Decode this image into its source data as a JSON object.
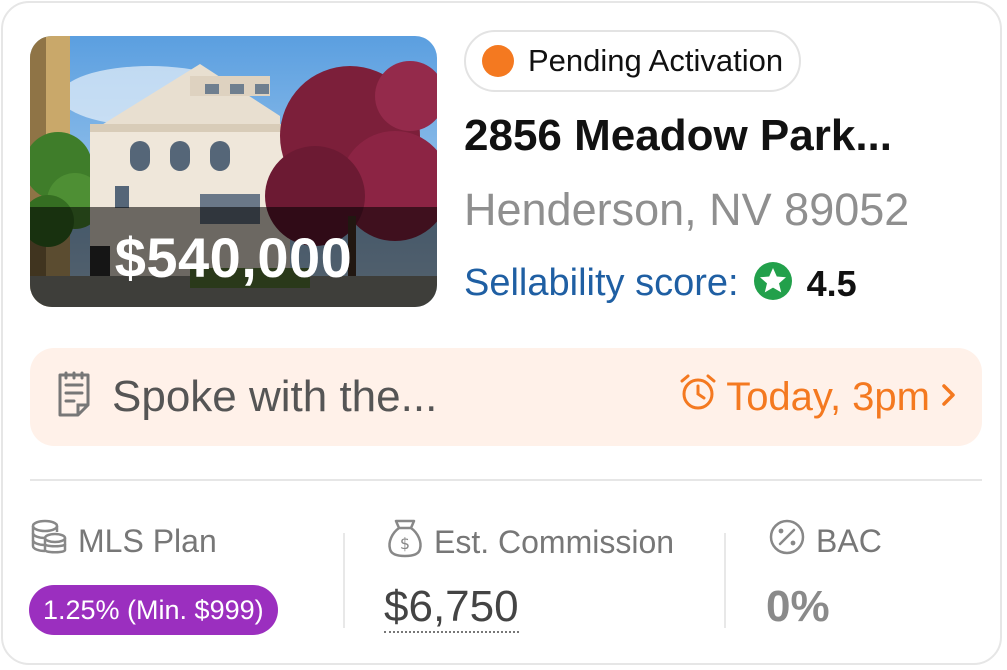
{
  "listing": {
    "price": "$540,000",
    "status": "Pending Activation",
    "address": "2856 Meadow Park...",
    "city": "Henderson, NV 89052",
    "sellability_label": "Sellability score:",
    "sellability_value": "4.5"
  },
  "note": {
    "text": "Spoke with the...",
    "when": "Today, 3pm"
  },
  "stats": {
    "mls_label": "MLS Plan",
    "mls_value": "1.25% (Min. $999)",
    "commission_label": "Est. Commission",
    "commission_value": "$6,750",
    "bac_label": "BAC",
    "bac_value": "0%"
  },
  "colors": {
    "status_dot": "#f47920",
    "accent_orange": "#f47920",
    "score_blue": "#1f5fa3",
    "score_green": "#22a04b",
    "note_bg": "#fff1e9",
    "badge_purple": "#9b2fbf"
  },
  "icons": {
    "status": "status-dot",
    "score": "star-badge-icon",
    "note": "note-icon",
    "time": "alarm-clock-icon",
    "chevron": "chevron-right-icon",
    "mls": "coins-stack-icon",
    "commission": "money-bag-icon",
    "bac": "percent-badge-icon"
  }
}
